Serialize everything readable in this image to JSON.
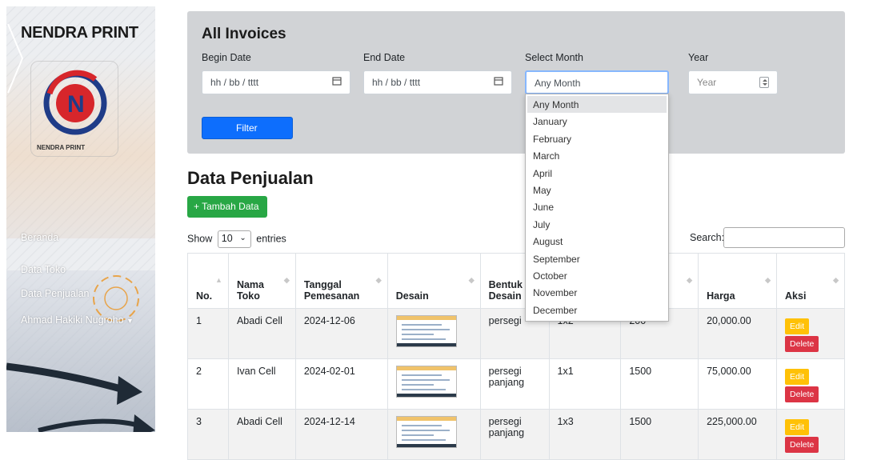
{
  "sidebar": {
    "brand": "NENDRA PRINT",
    "logo_caption": "NENDRA PRINT",
    "items": [
      {
        "label": "Beranda"
      },
      {
        "label": "Data Toko"
      },
      {
        "label": "Data Penjualan"
      },
      {
        "label": "Ahmad Hakiki Nugroho"
      }
    ]
  },
  "filter": {
    "title": "All Invoices",
    "begin_label": "Begin Date",
    "begin_placeholder": "hh / bb / tttt",
    "end_label": "End Date",
    "end_placeholder": "hh / bb / tttt",
    "month_label": "Select Month",
    "month_value": "Any Month",
    "year_label": "Year",
    "year_placeholder": "Year",
    "button": "Filter",
    "month_options": [
      "Any Month",
      "January",
      "February",
      "March",
      "April",
      "May",
      "June",
      "July",
      "August",
      "September",
      "October",
      "November",
      "December"
    ]
  },
  "main": {
    "title": "Data Penjualan",
    "add_button": "+ Tambah Data",
    "show_prefix": "Show",
    "show_value": "10",
    "show_suffix": "entries",
    "search_label": "Search:"
  },
  "table": {
    "headers": [
      "No.",
      "Nama Toko",
      "Tanggal Pemesanan",
      "Desain",
      "Bentuk Desain",
      "",
      "",
      "Harga",
      "Aksi"
    ],
    "rows": [
      {
        "no": "1",
        "toko": "Abadi Cell",
        "tanggal": "2024-12-06",
        "bentuk": "persegi",
        "ukuran": "1x2",
        "jumlah": "200",
        "harga": "20,000.00"
      },
      {
        "no": "2",
        "toko": "Ivan Cell",
        "tanggal": "2024-02-01",
        "bentuk": "persegi panjang",
        "ukuran": "1x1",
        "jumlah": "1500",
        "harga": "75,000.00"
      },
      {
        "no": "3",
        "toko": "Abadi Cell",
        "tanggal": "2024-12-14",
        "bentuk": "persegi panjang",
        "ukuran": "1x3",
        "jumlah": "1500",
        "harga": "225,000.00"
      }
    ],
    "edit_label": "Edit",
    "delete_label": "Delete"
  },
  "colors": {
    "primary": "#0d6efd",
    "success": "#28a745",
    "warning": "#ffc107",
    "danger": "#dc3545",
    "card": "#d1d3d6"
  }
}
